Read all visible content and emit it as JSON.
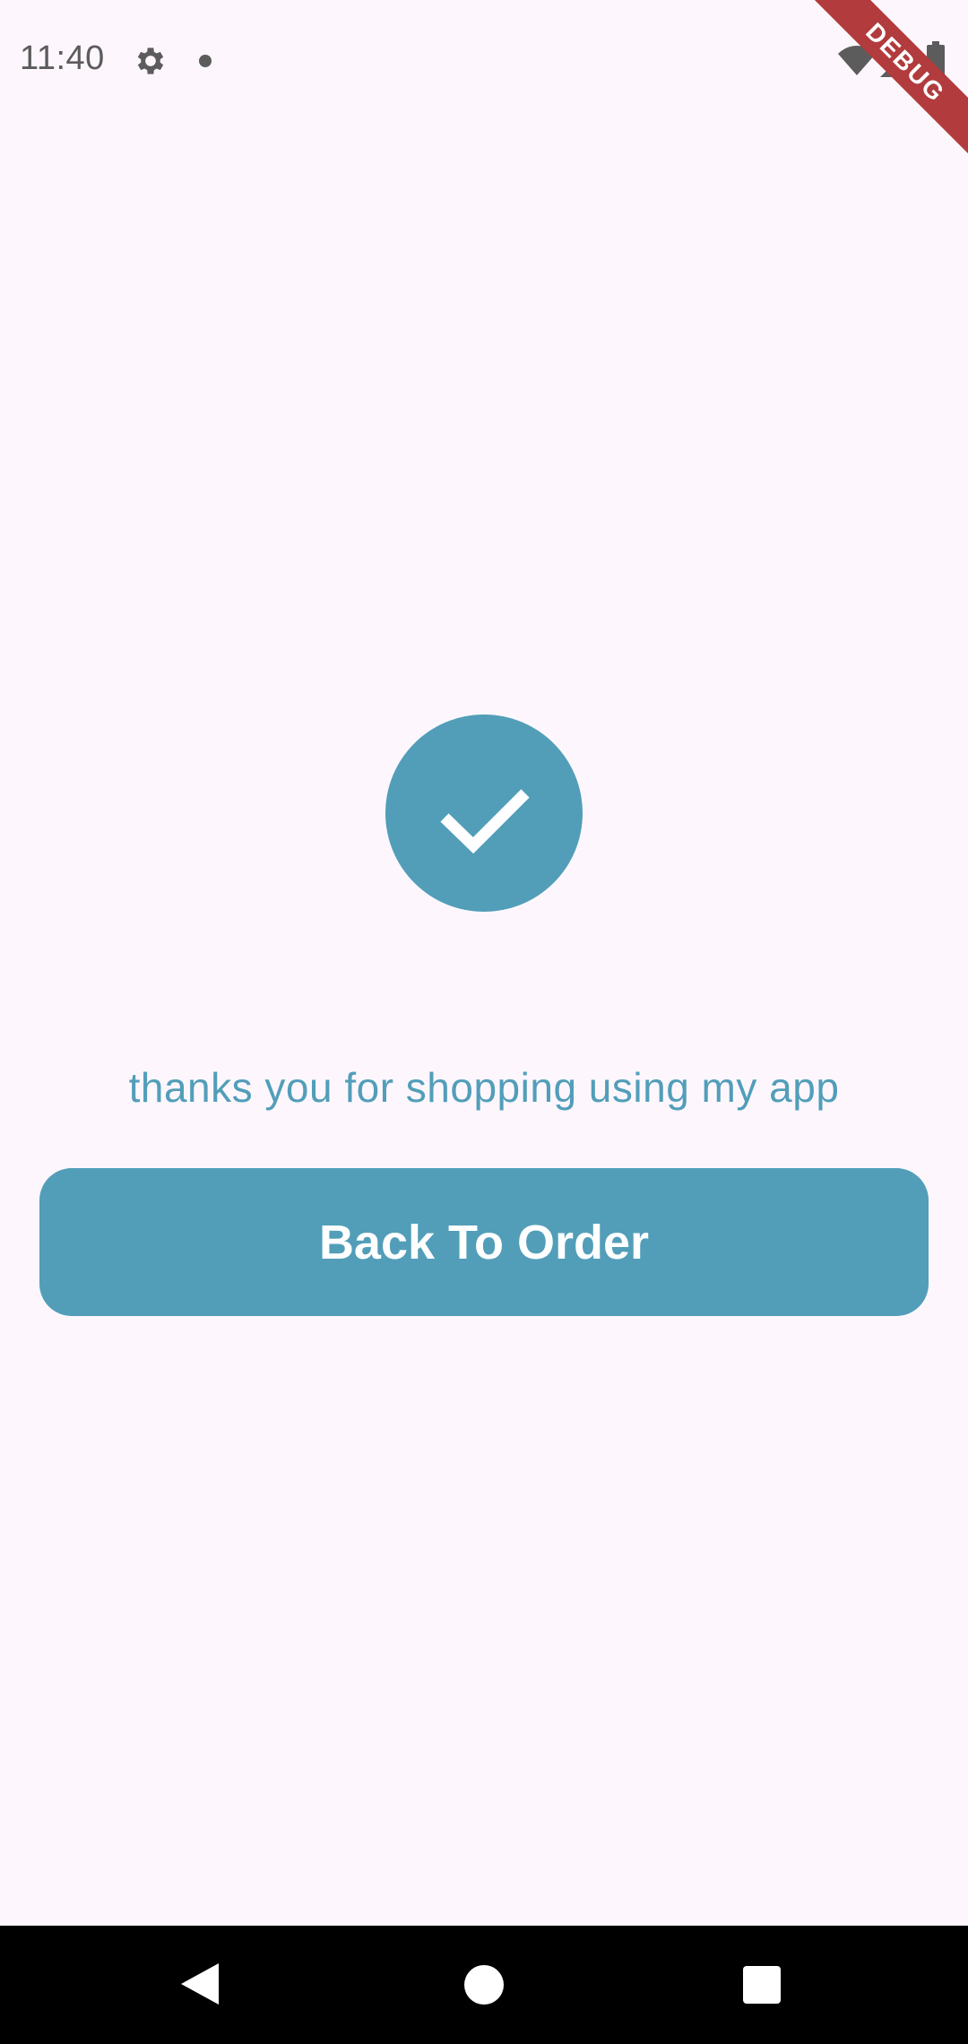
{
  "status_bar": {
    "time": "11:40",
    "icons": [
      "gear-icon",
      "notification-dot-icon",
      "wifi-icon",
      "signal-icon",
      "battery-icon"
    ]
  },
  "debug_banner": {
    "label": "DEBUG"
  },
  "success": {
    "icon": "check-icon",
    "message": "thanks you for shopping using my app"
  },
  "actions": {
    "back_label": "Back To Order"
  },
  "nav_bar": {
    "icons": [
      "back-triangle-icon",
      "home-circle-icon",
      "recents-square-icon"
    ]
  },
  "colors": {
    "accent": "#529eb9",
    "background": "#fdf7fd",
    "debug_banner": "#b13b3d",
    "status_icon": "#5c5c5c",
    "nav_bar": "#000000"
  }
}
